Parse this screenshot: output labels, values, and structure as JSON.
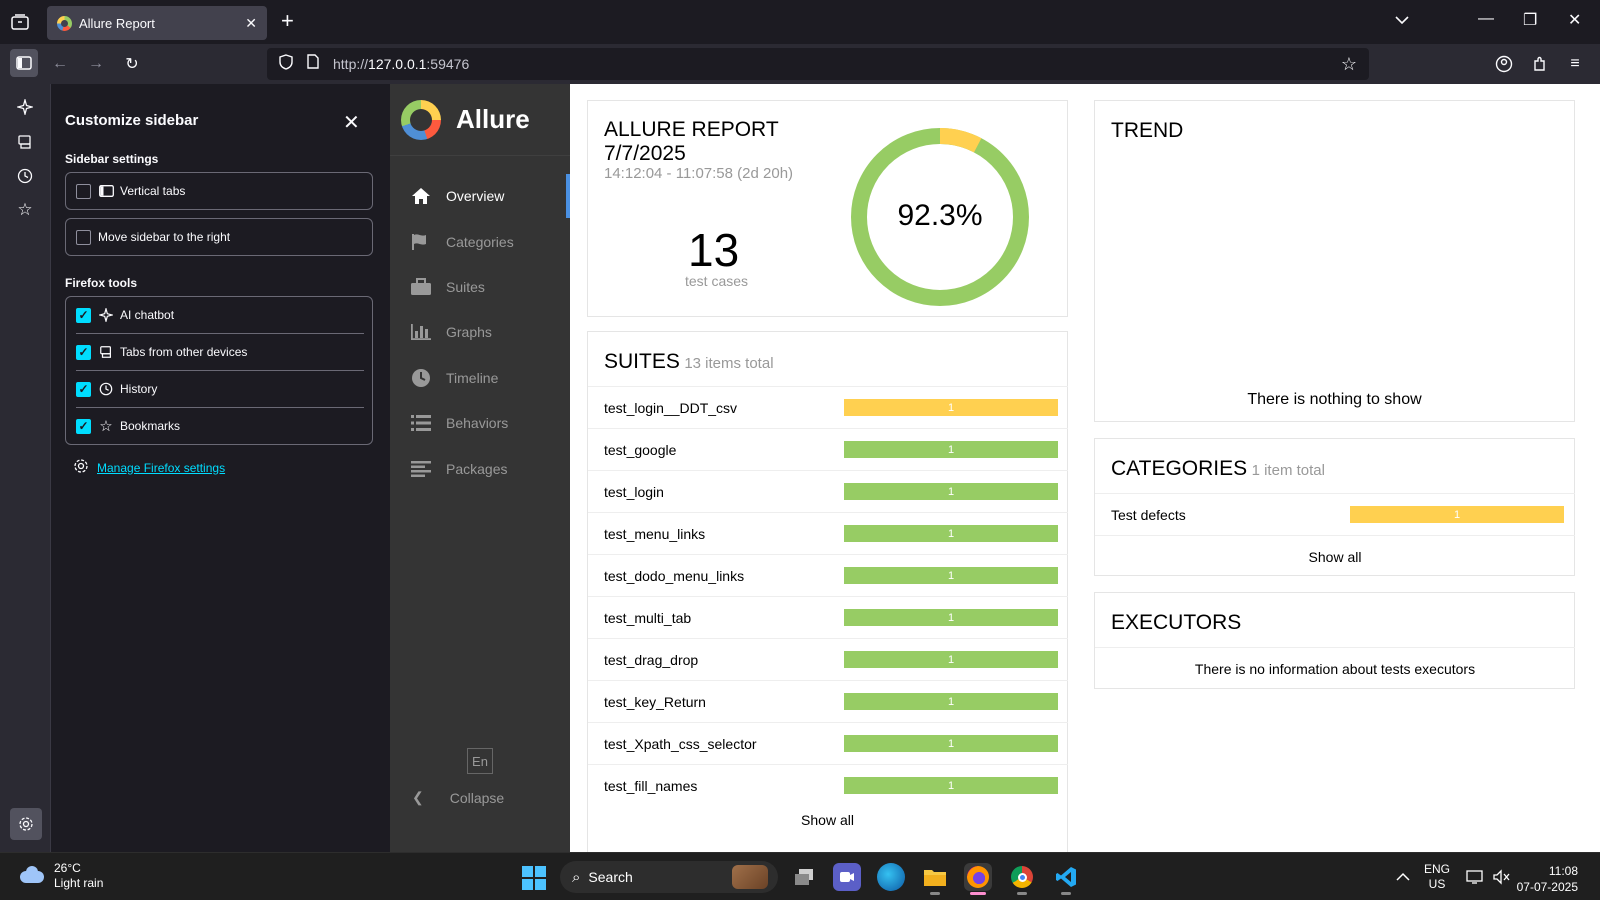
{
  "browser": {
    "tab_title": "Allure Report",
    "url_prefix": "http://",
    "url_host": "127.0.0.1",
    "url_port": ":59476"
  },
  "customize_sidebar": {
    "title": "Customize sidebar",
    "sidebar_settings_label": "Sidebar settings",
    "settings": [
      {
        "label": "Vertical tabs",
        "checked": false
      },
      {
        "label": "Move sidebar to the right",
        "checked": false
      }
    ],
    "firefox_tools_label": "Firefox tools",
    "tools": [
      {
        "label": "AI chatbot",
        "checked": true,
        "icon": "sparkle-icon"
      },
      {
        "label": "Tabs from other devices",
        "checked": true,
        "icon": "synced-tabs-icon"
      },
      {
        "label": "History",
        "checked": true,
        "icon": "history-icon"
      },
      {
        "label": "Bookmarks",
        "checked": true,
        "icon": "bookmark-star-icon"
      }
    ],
    "manage_link": "Manage Firefox settings"
  },
  "allure_nav": {
    "brand": "Allure",
    "items": [
      {
        "label": "Overview",
        "icon": "home-icon",
        "active": true
      },
      {
        "label": "Categories",
        "icon": "flag-icon",
        "active": false
      },
      {
        "label": "Suites",
        "icon": "briefcase-icon",
        "active": false
      },
      {
        "label": "Graphs",
        "icon": "bar-chart-icon",
        "active": false
      },
      {
        "label": "Timeline",
        "icon": "clock-icon",
        "active": false
      },
      {
        "label": "Behaviors",
        "icon": "list-icon",
        "active": false
      },
      {
        "label": "Packages",
        "icon": "align-left-icon",
        "active": false
      }
    ],
    "language": "En",
    "collapse": "Collapse"
  },
  "summary": {
    "title_line1": "ALLURE REPORT",
    "title_line2": "7/7/2025",
    "time_range": "14:12:04 - 11:07:58 (2d 20h)",
    "test_count": "13",
    "test_count_label": "test cases",
    "pass_rate": "92.3%",
    "passed_fraction": 0.923,
    "broken_fraction": 0.077,
    "colors": {
      "passed": "#97cc64",
      "broken": "#ffd050"
    }
  },
  "suites": {
    "title": "SUITES",
    "subtitle": "13 items total",
    "rows": [
      {
        "name": "test_login__DDT_csv",
        "count": "1",
        "status": "broken"
      },
      {
        "name": "test_google",
        "count": "1",
        "status": "passed"
      },
      {
        "name": "test_login",
        "count": "1",
        "status": "passed"
      },
      {
        "name": "test_menu_links",
        "count": "1",
        "status": "passed"
      },
      {
        "name": "test_dodo_menu_links",
        "count": "1",
        "status": "passed"
      },
      {
        "name": "test_multi_tab",
        "count": "1",
        "status": "passed"
      },
      {
        "name": "test_drag_drop",
        "count": "1",
        "status": "passed"
      },
      {
        "name": "test_key_Return",
        "count": "1",
        "status": "passed"
      },
      {
        "name": "test_Xpath_css_selector",
        "count": "1",
        "status": "passed"
      },
      {
        "name": "test_fill_names",
        "count": "1",
        "status": "passed"
      }
    ],
    "show_all": "Show all"
  },
  "trend": {
    "title": "TREND",
    "empty": "There is nothing to show"
  },
  "categories": {
    "title": "CATEGORIES",
    "subtitle": "1 item total",
    "rows": [
      {
        "name": "Test defects",
        "count": "1",
        "status": "broken"
      }
    ],
    "show_all": "Show all"
  },
  "executors": {
    "title": "EXECUTORS",
    "empty": "There is no information about tests executors"
  },
  "taskbar": {
    "weather_temp": "26°C",
    "weather_desc": "Light rain",
    "search_label": "Search",
    "lang_line1": "ENG",
    "lang_line2": "US",
    "time": "11:08",
    "date": "07-07-2025"
  }
}
